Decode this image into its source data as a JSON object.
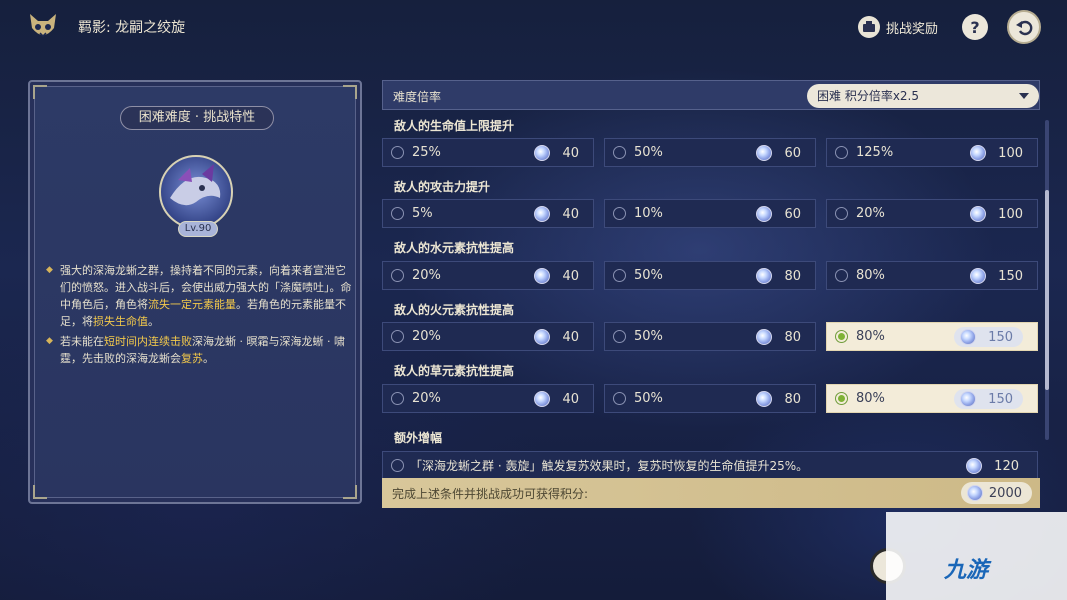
{
  "header": {
    "title": "羁影: 龙嗣之绞旋",
    "reward_label": "挑战奖励",
    "help_symbol": "?",
    "icons": [
      "fox-mask-icon",
      "reward-icon",
      "help-icon",
      "back-icon"
    ]
  },
  "left_card": {
    "heading": "困难难度 · 挑战特性",
    "boss_level": "Lv.90",
    "desc1_parts": [
      "强大的深海龙蜥之群，操持着不同的元素，向着来者宣泄它们的愤怒。进入战斗后，会使出威力强大的「涤魔啧吐」。命中角色后，角色将",
      "流失一定元素能量",
      "。若角色的元素能量不足，将",
      "损失生命值",
      "。"
    ],
    "desc2_parts": [
      "若未能在",
      "短时间内连续击败",
      "深海龙蜥 · 暝霜与深海龙蜥 · 啸霆，先击败的深海龙蜥会",
      "复苏",
      "。"
    ]
  },
  "difficulty": {
    "label": "难度倍率",
    "selected": "困难  积分倍率x2.5"
  },
  "sections": [
    {
      "title": "敌人的生命值上限提升",
      "options": [
        {
          "value": "25%",
          "points": "40",
          "selected": false
        },
        {
          "value": "50%",
          "points": "60",
          "selected": false
        },
        {
          "value": "125%",
          "points": "100",
          "selected": false
        }
      ]
    },
    {
      "title": "敌人的攻击力提升",
      "options": [
        {
          "value": "5%",
          "points": "40",
          "selected": false
        },
        {
          "value": "10%",
          "points": "60",
          "selected": false
        },
        {
          "value": "20%",
          "points": "100",
          "selected": false
        }
      ]
    },
    {
      "title": "敌人的水元素抗性提高",
      "options": [
        {
          "value": "20%",
          "points": "40",
          "selected": false
        },
        {
          "value": "50%",
          "points": "80",
          "selected": false
        },
        {
          "value": "80%",
          "points": "150",
          "selected": false
        }
      ]
    },
    {
      "title": "敌人的火元素抗性提高",
      "options": [
        {
          "value": "20%",
          "points": "40",
          "selected": false
        },
        {
          "value": "50%",
          "points": "80",
          "selected": false
        },
        {
          "value": "80%",
          "points": "150",
          "selected": true
        }
      ]
    },
    {
      "title": "敌人的草元素抗性提高",
      "options": [
        {
          "value": "20%",
          "points": "40",
          "selected": false
        },
        {
          "value": "50%",
          "points": "80",
          "selected": false
        },
        {
          "value": "80%",
          "points": "150",
          "selected": true
        }
      ]
    }
  ],
  "extra": {
    "title": "额外增幅",
    "text": "「深海龙蜥之群 · 轰旋」触发复苏效果时，复苏时恢复的生命值提升25%。",
    "points": "120"
  },
  "total": {
    "label": "完成上述条件并挑战成功可获得积分:",
    "points": "2000"
  },
  "watermark": {
    "text": "九游"
  },
  "colors": {
    "background": "#1b2750",
    "option_bg": "#1f2a52",
    "selected_bg": "#f3ecd9",
    "highlight": "#f3c94b",
    "total_bar": "#d8c79a"
  }
}
